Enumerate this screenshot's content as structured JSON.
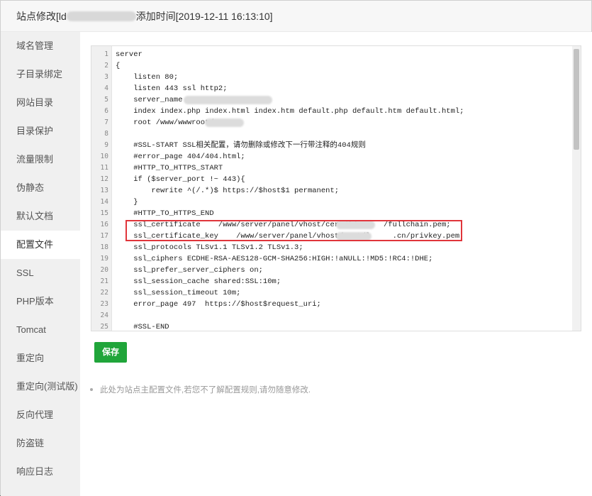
{
  "title": {
    "prefix": "站点修改[ld",
    "suffix": "添加时间[2019-12-11 16:13:10]"
  },
  "sidebar": {
    "items": [
      {
        "label": "域名管理"
      },
      {
        "label": "子目录绑定"
      },
      {
        "label": "网站目录"
      },
      {
        "label": "目录保护"
      },
      {
        "label": "流量限制"
      },
      {
        "label": "伪静态"
      },
      {
        "label": "默认文档"
      },
      {
        "label": "配置文件",
        "active": true
      },
      {
        "label": "SSL"
      },
      {
        "label": "PHP版本"
      },
      {
        "label": "Tomcat"
      },
      {
        "label": "重定向"
      },
      {
        "label": "重定向(测试版)"
      },
      {
        "label": "反向代理"
      },
      {
        "label": "防盗链"
      },
      {
        "label": "响应日志"
      }
    ]
  },
  "editor": {
    "line_numbers": [
      "1",
      "2",
      "3",
      "4",
      "5",
      "6",
      "7",
      "8",
      "9",
      "10",
      "11",
      "12",
      "13",
      "14",
      "15",
      "16",
      "17",
      "18",
      "19",
      "20",
      "21",
      "22",
      "23",
      "24",
      "25"
    ],
    "lines": [
      "server",
      "{",
      "    listen 80;",
      "    listen 443 ssl http2;",
      "    server_name",
      "    index index.php index.html index.htm default.php default.htm default.html;",
      "    root /www/wwwroot/",
      "",
      "    #SSL-START SSL相关配置，请勿删除或修改下一行带注释的404规则",
      "    #error_page 404/404.html;",
      "    #HTTP_TO_HTTPS_START",
      "    if ($server_port !~ 443){",
      "        rewrite ^(/.*)$ https://$host$1 permanent;",
      "    }",
      "    #HTTP_TO_HTTPS_END",
      "    ssl_certificate    /www/server/panel/vhost/cert/ld      /fullchain.pem;",
      "    ssl_certificate_key    /www/server/panel/vhost/cert/l     .cn/privkey.pem;",
      "    ssl_protocols TLSv1.1 TLSv1.2 TLSv1.3;",
      "    ssl_ciphers ECDHE-RSA-AES128-GCM-SHA256:HIGH:!aNULL:!MD5:!RC4:!DHE;",
      "    ssl_prefer_server_ciphers on;",
      "    ssl_session_cache shared:SSL:10m;",
      "    ssl_session_timeout 10m;",
      "    error_page 497  https://$host$request_uri;",
      "",
      "    #SSL-END"
    ]
  },
  "save_button": {
    "label": "保存"
  },
  "hint": {
    "text": "此处为站点主配置文件,若您不了解配置规则,请勿随意修改."
  },
  "colors": {
    "accent": "#20a53a",
    "highlight_border": "#e0353b"
  }
}
